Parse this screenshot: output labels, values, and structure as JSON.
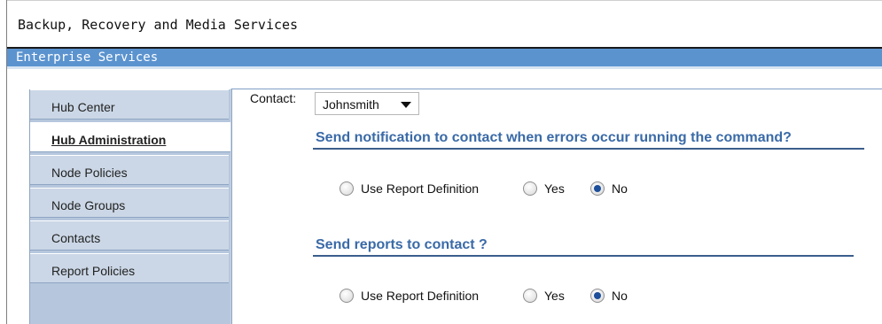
{
  "window": {
    "title": "Backup, Recovery and Media Services"
  },
  "band": {
    "title": "Enterprise Services"
  },
  "sidebar": {
    "items": [
      {
        "label": "Hub Center",
        "active": false
      },
      {
        "label": "Hub Administration",
        "active": true
      },
      {
        "label": "Node Policies",
        "active": false
      },
      {
        "label": "Node Groups",
        "active": false
      },
      {
        "label": "Contacts",
        "active": false
      },
      {
        "label": "Report Policies",
        "active": false
      }
    ]
  },
  "form": {
    "contact_label": "Contact:",
    "contact_value": "Johnsmith",
    "notify": {
      "heading": "Send notification to contact when errors occur running the command?",
      "options": [
        "Use Report Definition",
        "Yes",
        "No"
      ],
      "selected": "No"
    },
    "reports": {
      "heading": "Send reports to contact ?",
      "options": [
        "Use Report Definition",
        "Yes",
        "No"
      ],
      "selected": "No"
    }
  }
}
